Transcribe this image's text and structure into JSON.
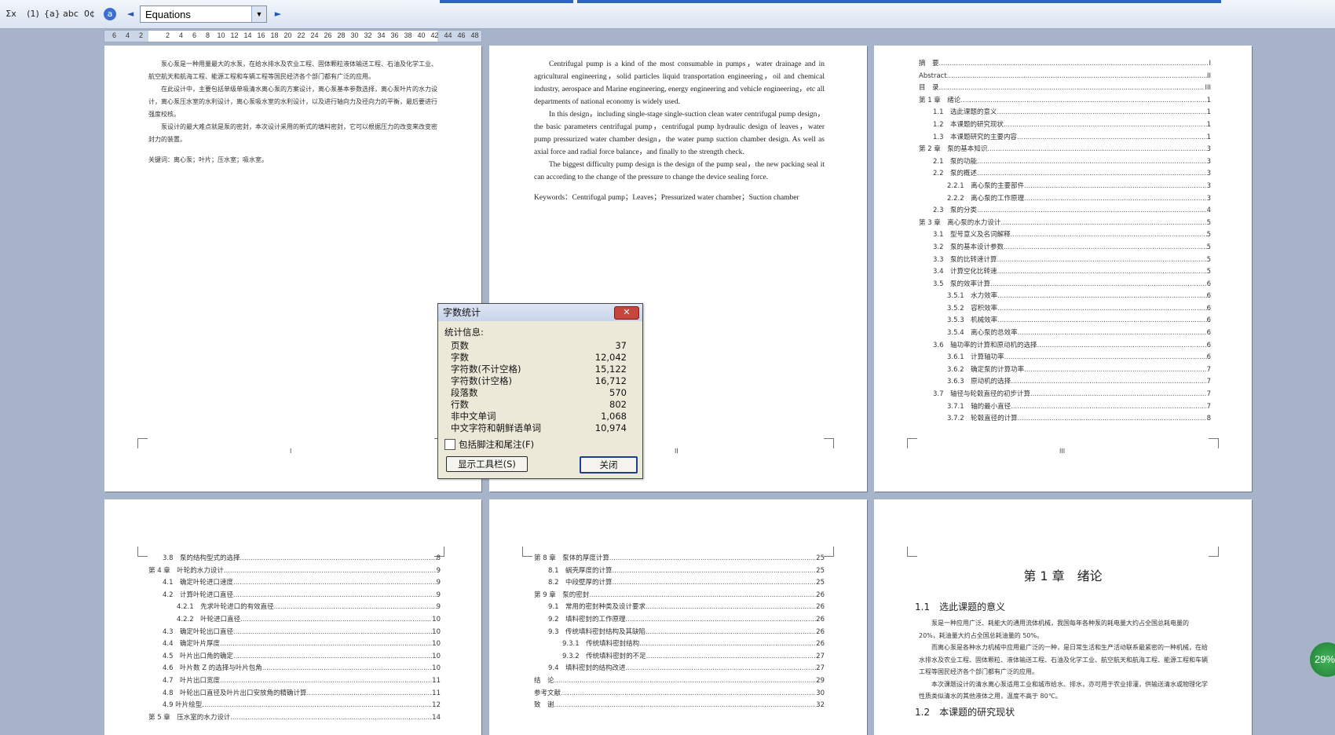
{
  "toolbar": {
    "buttons": [
      "Σx",
      "(1)",
      "{a}",
      "abc",
      "0¢",
      "a",
      "◄",
      "►"
    ],
    "combo_value": "Equations"
  },
  "ruler": {
    "ticks": [
      "6",
      "4",
      "2",
      "",
      "2",
      "4",
      "6",
      "8",
      "10",
      "12",
      "14",
      "16",
      "18",
      "20",
      "22",
      "24",
      "26",
      "28",
      "30",
      "32",
      "34",
      "36",
      "38",
      "40",
      "42",
      "44",
      "46",
      "48"
    ]
  },
  "page1": {
    "paras": [
      "泵心泵是一种用量最大的水泵，在给水排水及农业工程、固体颗粒液体输送工程、石油及化学工业、航空航天和航海工程、能源工程和车辆工程等国民经济各个部门都有广泛的应用。",
      "在此设计中，主要包括单级单吸清水离心泵的方案设计，离心泵基本参数选择，离心泵叶片的水力设计，离心泵压水室的水利设计，离心泵吸水室的水利设计，以及进行轴向力及径向力的平衡，最后要进行强度校核。",
      "泵设计的最大难点就是泵的密封，本次设计采用的新式的填料密封，它可以根据压力的改变来改变密封力的装置。"
    ],
    "keywords": "关键词：离心泵；叶片；压水室；吸水室。",
    "footer": "I"
  },
  "page2": {
    "paras": [
      "Centrifugal pump is a kind of the most consumable in pumps，water drainage and in agricultural engineering，solid particles liquid transportation engineering，oil and chemical industry, aerospace and Marine engineering, energy engineering and vehicle engineering，etc all departments of national economy is widely used.",
      "In this design，including single-stage single-suction clean water centrifugal pump design，the basic parameters centrifugal pump，centrifugal pump hydraulic design of leaves，water pump pressurized water chamber design，the water pump suction chamber design. As well as axial force and radial force balance，and finally to the strength check.",
      "The biggest difficulty pump design is the design of the pump seal，the new packing seal it can according to the change of the pressure to change the device sealing force."
    ],
    "keywords": "Keywords：Centrifugal pump；Leaves；Pressurized water chamber；Suction chamber",
    "footer": "II"
  },
  "page3": {
    "toc": [
      {
        "t": "摘　要",
        "p": "I",
        "l": 0
      },
      {
        "t": "Abstract",
        "p": "II",
        "l": 0
      },
      {
        "t": "目　录",
        "p": "III",
        "l": 0
      },
      {
        "t": "第 1 章　绪论",
        "p": "1",
        "l": 0
      },
      {
        "t": "1.1　选此课题的意义",
        "p": "1",
        "l": 1
      },
      {
        "t": "1.2　本课题的研究现状",
        "p": "1",
        "l": 1
      },
      {
        "t": "1.3　本课题研究的主要内容",
        "p": "1",
        "l": 1
      },
      {
        "t": "第 2 章　泵的基本知识",
        "p": "3",
        "l": 0
      },
      {
        "t": "2.1　泵的功能",
        "p": "3",
        "l": 1
      },
      {
        "t": "2.2　泵的概述",
        "p": "3",
        "l": 1
      },
      {
        "t": "2.2.1　离心泵的主要部件",
        "p": "3",
        "l": 2
      },
      {
        "t": "2.2.2　离心泵的工作原理",
        "p": "3",
        "l": 2
      },
      {
        "t": "2.3　泵的分类",
        "p": "4",
        "l": 1
      },
      {
        "t": "第 3 章　离心泵的水力设计",
        "p": "5",
        "l": 0
      },
      {
        "t": "3.1　型号意义及名词解释",
        "p": "5",
        "l": 1
      },
      {
        "t": "3.2　泵的基本设计参数",
        "p": "5",
        "l": 1
      },
      {
        "t": "3.3　泵的比转速计算",
        "p": "5",
        "l": 1
      },
      {
        "t": "3.4　计算空化比转速",
        "p": "5",
        "l": 1
      },
      {
        "t": "3.5　泵的效率计算",
        "p": "6",
        "l": 1
      },
      {
        "t": "3.5.1　水力效率",
        "p": "6",
        "l": 2
      },
      {
        "t": "3.5.2　容积效率",
        "p": "6",
        "l": 2
      },
      {
        "t": "3.5.3　机械效率",
        "p": "6",
        "l": 2
      },
      {
        "t": "3.5.4　离心泵的总效率",
        "p": "6",
        "l": 2
      },
      {
        "t": "3.6　轴功率的计算和原动机的选择",
        "p": "6",
        "l": 1
      },
      {
        "t": "3.6.1　计算轴功率",
        "p": "6",
        "l": 2
      },
      {
        "t": "3.6.2　确定泵的计算功率",
        "p": "7",
        "l": 2
      },
      {
        "t": "3.6.3　原动机的选择",
        "p": "7",
        "l": 2
      },
      {
        "t": "3.7　轴径与轮毂直径的初步计算",
        "p": "7",
        "l": 1
      },
      {
        "t": "3.7.1　轴的最小直径",
        "p": "7",
        "l": 2
      },
      {
        "t": "3.7.2　轮毂直径的计算",
        "p": "8",
        "l": 2
      }
    ],
    "footer": "III"
  },
  "page4": {
    "toc": [
      {
        "t": "3.8　泵的结构型式的选择",
        "p": "8",
        "l": 1
      },
      {
        "t": "第 4 章　叶轮的水力设计",
        "p": "9",
        "l": 0
      },
      {
        "t": "4.1　确定叶轮进口速度",
        "p": "9",
        "l": 1
      },
      {
        "t": "4.2　计算叶轮进口直径",
        "p": "9",
        "l": 1
      },
      {
        "t": "4.2.1　先求叶轮进口的有效直径",
        "p": "9",
        "l": 2
      },
      {
        "t": "4.2.2　叶轮进口直径",
        "p": "10",
        "l": 2
      },
      {
        "t": "4.3　确定叶轮出口直径",
        "p": "10",
        "l": 1
      },
      {
        "t": "4.4　确定叶片厚度",
        "p": "10",
        "l": 1
      },
      {
        "t": "4.5　叶片出口角的确定",
        "p": "10",
        "l": 1
      },
      {
        "t": "4.6　叶片数 Z 的选择与叶片包角",
        "p": "10",
        "l": 1
      },
      {
        "t": "4.7　叶片出口宽度",
        "p": "11",
        "l": 1
      },
      {
        "t": "4.8　叶轮出口直径及叶片出口安放角的精确计算",
        "p": "11",
        "l": 1
      },
      {
        "t": "4.9  叶片绘型",
        "p": "12",
        "l": 1
      },
      {
        "t": "第 5 章　压水室的水力设计",
        "p": "14",
        "l": 0
      }
    ]
  },
  "page5": {
    "toc": [
      {
        "t": "第 8 章　泵体的厚度计算",
        "p": "25",
        "l": 0
      },
      {
        "t": "8.1　蜗壳厚度的计算",
        "p": "25",
        "l": 1
      },
      {
        "t": "8.2　中段壁厚的计算",
        "p": "25",
        "l": 1
      },
      {
        "t": "第 9 章　泵的密封",
        "p": "26",
        "l": 0
      },
      {
        "t": "9.1　常用的密封种类及设计要求",
        "p": "26",
        "l": 1
      },
      {
        "t": "9.2　填料密封的工作原理",
        "p": "26",
        "l": 1
      },
      {
        "t": "9.3　传统填料密封结构及其缺陷",
        "p": "26",
        "l": 1
      },
      {
        "t": "9.3.1　传统填料密封结构",
        "p": "26",
        "l": 2
      },
      {
        "t": "9.3.2　传统填料密封的不足",
        "p": "27",
        "l": 2
      },
      {
        "t": "9.4　填料密封的结构改进",
        "p": "27",
        "l": 1
      },
      {
        "t": "结　论",
        "p": "29",
        "l": 0
      },
      {
        "t": "参考文献",
        "p": "30",
        "l": 0
      },
      {
        "t": "致　谢",
        "p": "32",
        "l": 0
      }
    ]
  },
  "page6": {
    "chapter": "第 1 章　绪论",
    "h1": "1.1　选此课题的意义",
    "p1": "泵是一种应用广泛、耗能大的通用流体机械，我国每年各种泵的耗电量大约占全国总耗电量的 20%，耗油量大约占全国总耗油量的 50%。",
    "p2": "而离心泵是各种水力机械中应用最广泛的一种，是日常生活和生产活动联系最紧密的一种机械，在给水排水及农业工程、固体颗粒、液体输送工程、石油及化学工业、航空航天和航海工程、能源工程和车辆工程等国民经济各个部门都有广泛的应用。",
    "p3": "本次课题设计的清水离心泵适用工业和城市给水、排水，亦可用于农业排灌，供输送清水或物理化学性质类似清水的其他液体之用，温度不高于 80℃。",
    "h2": "1.2　本课题的研究现状"
  },
  "dialog": {
    "title": "字数统计",
    "close_glyph": "✕",
    "section": "统计信息:",
    "stats": [
      {
        "k": "页数",
        "v": "37"
      },
      {
        "k": "字数",
        "v": "12,042"
      },
      {
        "k": "字符数(不计空格)",
        "v": "15,122"
      },
      {
        "k": "字符数(计空格)",
        "v": "16,712"
      },
      {
        "k": "段落数",
        "v": "570"
      },
      {
        "k": "行数",
        "v": "802"
      },
      {
        "k": "非中文单词",
        "v": "1,068"
      },
      {
        "k": "中文字符和朝鲜语单词",
        "v": "10,974"
      }
    ],
    "checkbox_label": "包括脚注和尾注(F)",
    "toolbar_button": "显示工具栏(S)",
    "close_button": "关闭"
  },
  "zoom": "29%"
}
